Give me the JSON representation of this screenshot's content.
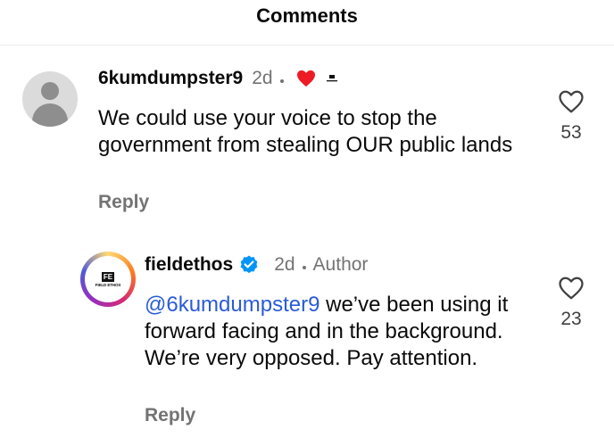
{
  "header": {
    "title": "Comments"
  },
  "comments": [
    {
      "username": "6kumdumpster9",
      "time": "2d",
      "text": "We could use your voice to stop the government from stealing OUR public lands",
      "reply_label": "Reply",
      "like_count": "53",
      "liked_by_creator": true,
      "accent_color": "#ed1c24"
    },
    {
      "username": "fieldethos",
      "time": "2d",
      "author_label": "Author",
      "mention": "@6kumdumpster9",
      "text": "we’ve been using it forward facing and in the background. We’re very opposed. Pay attention.",
      "reply_label": "Reply",
      "like_count": "23",
      "verified": true,
      "avatar_mark": "FE",
      "avatar_name": "FIELD ETHOS",
      "mention_color": "#2a5bd7",
      "verified_color": "#0095f6"
    }
  ]
}
